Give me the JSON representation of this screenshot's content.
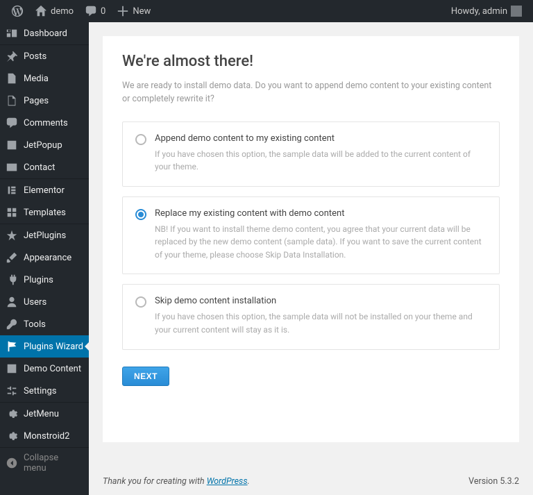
{
  "adminbar": {
    "site_name": "demo",
    "comments_count": "0",
    "new_label": "New",
    "greeting": "Howdy, admin"
  },
  "sidebar": {
    "items": [
      {
        "label": "Dashboard",
        "icon": "dashboard"
      },
      {
        "label": "Posts",
        "icon": "pin"
      },
      {
        "label": "Media",
        "icon": "media"
      },
      {
        "label": "Pages",
        "icon": "page"
      },
      {
        "label": "Comments",
        "icon": "comment"
      },
      {
        "label": "JetPopup",
        "icon": "popup"
      },
      {
        "label": "Contact",
        "icon": "envelope"
      },
      {
        "label": "Elementor",
        "icon": "elementor"
      },
      {
        "label": "Templates",
        "icon": "templates"
      },
      {
        "label": "JetPlugins",
        "icon": "jet"
      },
      {
        "label": "Appearance",
        "icon": "brush"
      },
      {
        "label": "Plugins",
        "icon": "plug"
      },
      {
        "label": "Users",
        "icon": "user"
      },
      {
        "label": "Tools",
        "icon": "wrench"
      },
      {
        "label": "Plugins Wizard",
        "icon": "flag",
        "current": true
      },
      {
        "label": "Demo Content",
        "icon": "inbox"
      },
      {
        "label": "Settings",
        "icon": "sliders"
      },
      {
        "label": "JetMenu",
        "icon": "gear"
      },
      {
        "label": "Monstroid2",
        "icon": "gear"
      },
      {
        "label": "Collapse menu",
        "icon": "collapse",
        "collapse": true
      }
    ]
  },
  "main": {
    "heading": "We're almost there!",
    "sub": "We are ready to install demo data. Do you want to append demo content to your existing content or completely rewrite it?",
    "options": [
      {
        "title": "Append demo content to my existing content",
        "desc": "If you have chosen this option, the sample data will be added to the current content of your theme.",
        "selected": false
      },
      {
        "title": "Replace my existing content with demo content",
        "desc": "NB! If you want to install theme demo content, you agree that your current data will be replaced by the new demo content (sample data). If you want to save the current content of your theme, please choose Skip Data Installation.",
        "selected": true
      },
      {
        "title": "Skip demo content installation",
        "desc": "If you have chosen this option, the sample data will not be installed on your theme and your current content will stay as it is.",
        "selected": false
      }
    ],
    "next_label": "NEXT"
  },
  "footer": {
    "thanks_prefix": "Thank you for creating with ",
    "link_text": "WordPress",
    "thanks_suffix": ".",
    "version": "Version 5.3.2"
  }
}
